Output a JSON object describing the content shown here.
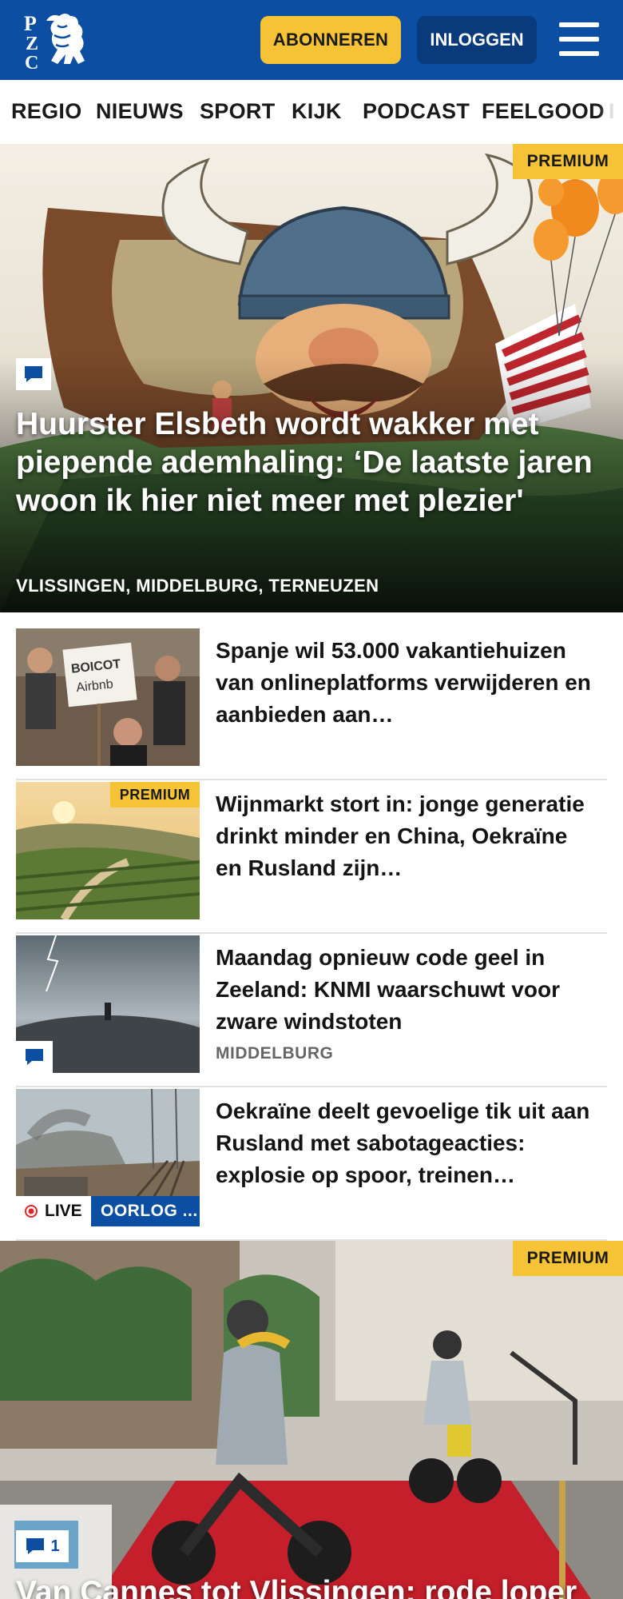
{
  "header": {
    "logo_text": "PZC",
    "subscribe_label": "ABONNEREN",
    "login_label": "INLOGGEN",
    "brand_color": "#0b4ea2",
    "accent_color": "#f5c335"
  },
  "nav": {
    "items": [
      "REGIO",
      "NIEUWS",
      "SPORT",
      "KIJK",
      "PODCAST",
      "FEELGOOD"
    ]
  },
  "hero": {
    "badge": "PREMIUM",
    "title": "Huurster Elsbeth wordt wakker met piepende ademhaling: ‘De laatste jaren woon ik hier niet meer met plezier'",
    "location": "VLISSINGEN, MIDDELBURG, TERNEUZEN",
    "icon": "comment-icon"
  },
  "articles": [
    {
      "title": "Spanje wil 53.000 vakantiehui­zen van onlineplatforms verwijderen en aanbieden aan…",
      "sign_line1": "BOICOT",
      "sign_line2": "Airbnb"
    },
    {
      "badge": "PREMIUM",
      "title": "Wijnmarkt stort in: jonge generatie drinkt minder en China, Oekraïne en Rusland zijn…"
    },
    {
      "title": "Maandag opnieuw code geel in Zeeland: KNMI waarschuwt voor zware windstoten",
      "location": "MIDDELBURG",
      "icon": "comment-icon"
    },
    {
      "title": "Oekraïne deelt gevoelige tik uit aan Rusland met sabotageacties: explosie op spoor, treinen…",
      "live_label": "LIVE",
      "tag_label": "OORLOG ..."
    }
  ],
  "hero2": {
    "badge": "PREMIUM",
    "comment_count": "1",
    "title": "Van Cannes tot Vlissingen: rode loper"
  }
}
